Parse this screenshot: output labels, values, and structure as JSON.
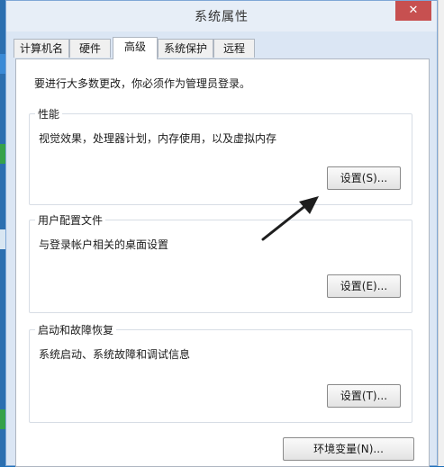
{
  "window": {
    "title": "系统属性",
    "close_label": "✕"
  },
  "tabs": [
    {
      "label": "计算机名"
    },
    {
      "label": "硬件"
    },
    {
      "label": "高级",
      "active": true
    },
    {
      "label": "系统保护"
    },
    {
      "label": "远程"
    }
  ],
  "panel": {
    "notice": "要进行大多数更改，你必须作为管理员登录。",
    "performance": {
      "title": "性能",
      "description": "视觉效果，处理器计划，内存使用，以及虚拟内存",
      "button": "设置(S)..."
    },
    "user_profiles": {
      "title": "用户配置文件",
      "description": "与登录帐户相关的桌面设置",
      "button": "设置(E)..."
    },
    "startup_recovery": {
      "title": "启动和故障恢复",
      "description": "系统启动、系统故障和调试信息",
      "button": "设置(T)..."
    },
    "env_button": "环境变量(N)..."
  },
  "colors": {
    "close_button": "#c75050",
    "window_frame": "#dbe6f4",
    "arrow": "#1e1e1e"
  }
}
